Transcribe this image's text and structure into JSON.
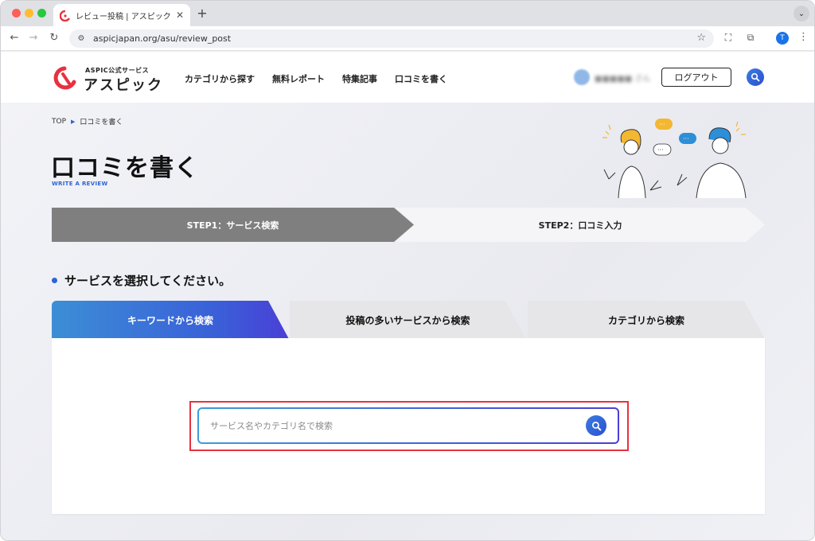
{
  "browser": {
    "tab_title": "レビュー投稿 | アスピック | SaaS",
    "url": "aspicjapan.org/asu/review_post",
    "profile_initial": "T"
  },
  "site": {
    "logo_small": "ASPIC公式サービス",
    "logo_main": "アスピック",
    "nav": [
      "カテゴリから探す",
      "無料レポート",
      "特集記事",
      "口コミを書く"
    ],
    "user_name": "■■■■■ さん",
    "logout_label": "ログアウト"
  },
  "page": {
    "breadcrumb": [
      "TOP",
      "口コミを書く"
    ],
    "title": "口コミを書く",
    "subtitle": "WRITE A REVIEW",
    "steps": [
      "STEP1：サービス検索",
      "STEP2：口コミ入力"
    ],
    "section_title": "サービスを選択してください。",
    "tabs": [
      "キーワードから検索",
      "投稿の多いサービスから検索",
      "カテゴリから検索"
    ],
    "search_placeholder": "サービス名やカテゴリ名で検索",
    "search_value": ""
  },
  "colors": {
    "accent": "#2e63d6",
    "step_active": "#7f7f7f",
    "highlight": "#e8313f",
    "logo_red": "#e8313f"
  }
}
